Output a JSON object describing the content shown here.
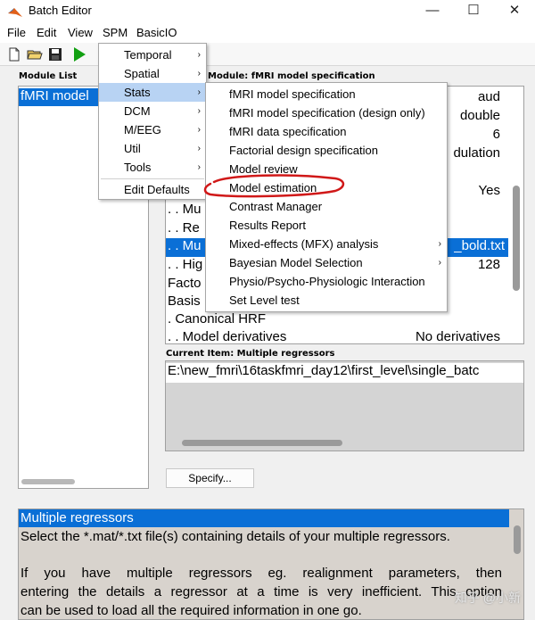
{
  "window": {
    "title": "Batch Editor",
    "minimize_glyph": "—",
    "maximize_glyph": "☐",
    "close_glyph": "✕"
  },
  "menubar": [
    "File",
    "Edit",
    "View",
    "SPM",
    "BasicIO"
  ],
  "toolbar": {
    "icons": [
      "new-file-icon",
      "open-folder-icon",
      "save-disk-icon",
      "run-play-icon"
    ],
    "run_color": "#12a012"
  },
  "module_list": {
    "label": "Module List",
    "selected": "fMRI model"
  },
  "module_panel": {
    "label": "Module: fMRI model specification"
  },
  "tree": {
    "rows": [
      {
        "text": ". . Mu",
        "value": ""
      },
      {
        "text": ". . Re",
        "value": ""
      },
      {
        "text": ". . Mu",
        "value": "_bold.txt",
        "selected": true
      },
      {
        "text": ". . Hig",
        "value": "128"
      },
      {
        "text": "Facto",
        "value": ""
      },
      {
        "text": "Basis",
        "value": ""
      },
      {
        "text": ". Canonical HRF",
        "value": ""
      },
      {
        "text": ". . Model derivatives",
        "value": "No derivatives"
      }
    ],
    "right_values": [
      "aud",
      "double",
      "6",
      "dulation",
      "",
      "Yes"
    ]
  },
  "current_item": {
    "label": "Current Item: Multiple regressors",
    "value": "E:\\new_fmri\\16taskfmri_day12\\first_level\\single_batc"
  },
  "specify_button": "Specify...",
  "help": {
    "title": "Multiple regressors",
    "lines": [
      "Select the *.mat/*.txt file(s) containing details of your multiple regressors.",
      "",
      "If you have multiple regressors eg. realignment parameters, then",
      "entering the details a regressor at a time is very inefficient. This option",
      "can be used to load all the required information in one go."
    ]
  },
  "spm_menu": {
    "items": [
      {
        "label": "Temporal",
        "submenu": true
      },
      {
        "label": "Spatial",
        "submenu": true
      },
      {
        "label": "Stats",
        "submenu": true,
        "active": true
      },
      {
        "label": "DCM",
        "submenu": true
      },
      {
        "label": "M/EEG",
        "submenu": true
      },
      {
        "label": "Util",
        "submenu": true
      },
      {
        "label": "Tools",
        "submenu": true
      },
      {
        "label": "Edit Defaults",
        "submenu": false
      }
    ]
  },
  "stats_menu": {
    "items": [
      {
        "label": "fMRI model specification",
        "submenu": false
      },
      {
        "label": "fMRI model specification (design only)",
        "submenu": false
      },
      {
        "label": "fMRI data specification",
        "submenu": false
      },
      {
        "label": "Factorial design specification",
        "submenu": false
      },
      {
        "label": "Model review",
        "submenu": false
      },
      {
        "label": "Model estimation",
        "submenu": false,
        "circled": true
      },
      {
        "label": "Contrast Manager",
        "submenu": false
      },
      {
        "label": "Results Report",
        "submenu": false
      },
      {
        "label": "Mixed-effects (MFX) analysis",
        "submenu": true
      },
      {
        "label": "Bayesian Model Selection",
        "submenu": true
      },
      {
        "label": "Physio/Psycho-Physiologic Interaction",
        "submenu": false
      },
      {
        "label": "Set Level test",
        "submenu": false
      }
    ]
  },
  "annotation": {
    "color": "#d01818"
  },
  "submenu_arrow": "›",
  "watermark": "知乎 @小新"
}
